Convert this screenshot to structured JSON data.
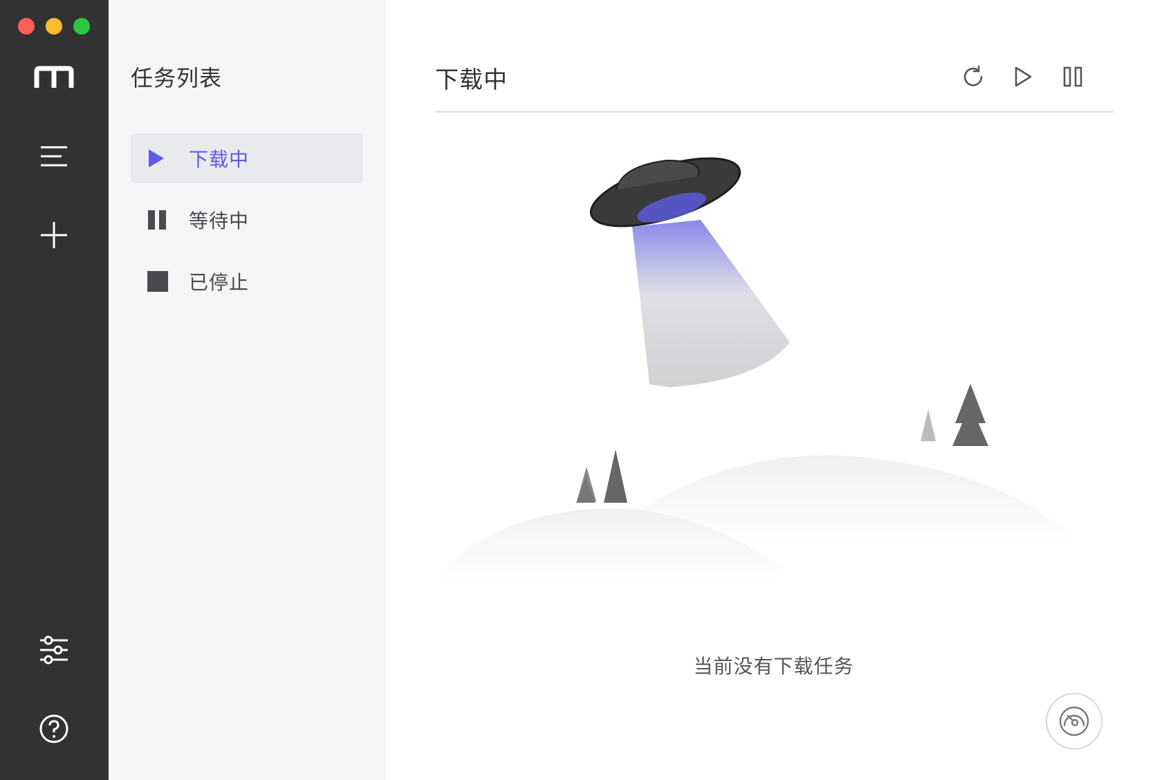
{
  "window": {
    "controls": [
      {
        "name": "close",
        "color": "#fe5f57"
      },
      {
        "name": "minimize",
        "color": "#febc2e"
      },
      {
        "name": "zoom",
        "color": "#28c840"
      }
    ]
  },
  "rail": {
    "items": [
      {
        "name": "logo",
        "icon": "motrix-logo-icon"
      },
      {
        "name": "task-list",
        "icon": "menu-lines-icon"
      },
      {
        "name": "add-task",
        "icon": "plus-icon"
      },
      {
        "name": "preferences",
        "icon": "sliders-icon"
      },
      {
        "name": "help",
        "icon": "help-circle-icon"
      }
    ]
  },
  "task_panel": {
    "title": "任务列表",
    "items": [
      {
        "label": "下载中",
        "icon": "play-icon",
        "active": true
      },
      {
        "label": "等待中",
        "icon": "pause-icon",
        "active": false
      },
      {
        "label": "已停止",
        "icon": "stop-icon",
        "active": false
      }
    ]
  },
  "main": {
    "title": "下载中",
    "toolbar": [
      {
        "name": "refresh",
        "icon": "refresh-icon"
      },
      {
        "name": "resume-all",
        "icon": "play-outline-icon"
      },
      {
        "name": "pause-all",
        "icon": "pause-outline-icon"
      }
    ],
    "empty_message": "当前没有下载任务",
    "speedometer_icon": "speedometer-icon"
  },
  "colors": {
    "rail_bg": "#323234",
    "panel_bg": "#f4f5f7",
    "accent": "#5b5bea",
    "icon_gray": "#4a4a4e"
  }
}
